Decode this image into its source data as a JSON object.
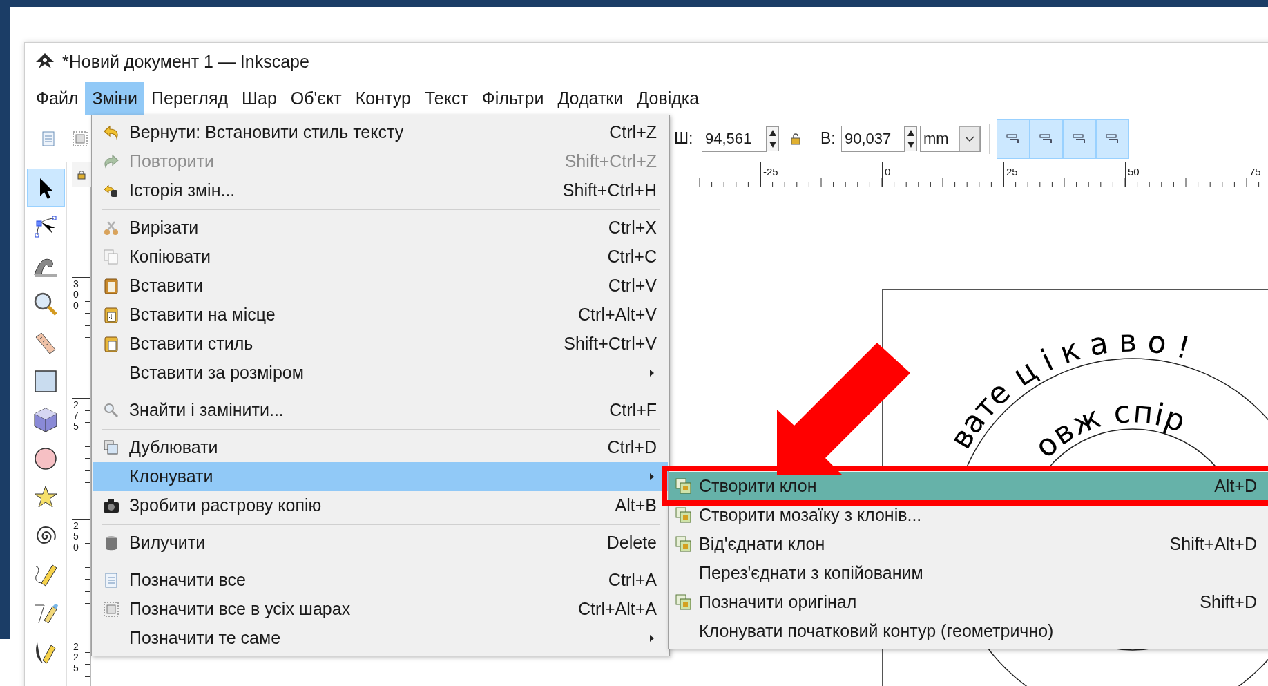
{
  "window": {
    "title": "*Новий документ 1 — Inkscape"
  },
  "menubar": [
    {
      "label": "Файл",
      "selected": false
    },
    {
      "label": "Зміни",
      "selected": true
    },
    {
      "label": "Перегляд",
      "selected": false
    },
    {
      "label": "Шар",
      "selected": false
    },
    {
      "label": "Об'єкт",
      "selected": false
    },
    {
      "label": "Контур",
      "selected": false
    },
    {
      "label": "Текст",
      "selected": false
    },
    {
      "label": "Фільтри",
      "selected": false
    },
    {
      "label": "Додатки",
      "selected": false
    },
    {
      "label": "Довідка",
      "selected": false
    }
  ],
  "toolbar": {
    "width_label": "Ш:",
    "width_value": "94,561",
    "height_label": "В:",
    "height_value": "90,037",
    "unit": "mm",
    "toggles": [
      {
        "selected": true
      },
      {
        "selected": true
      },
      {
        "selected": true
      },
      {
        "selected": true
      }
    ]
  },
  "toolbox": [
    {
      "selected": true
    },
    {
      "selected": false
    },
    {
      "selected": false
    },
    {
      "selected": false
    },
    {
      "selected": false
    },
    {
      "selected": false
    },
    {
      "selected": false
    },
    {
      "selected": false
    },
    {
      "selected": false
    },
    {
      "selected": false
    },
    {
      "selected": false
    },
    {
      "selected": false
    },
    {
      "selected": false
    }
  ],
  "rulers": {
    "horizontal": [
      "-25",
      "0",
      "25",
      "50",
      "75"
    ],
    "vertical": [
      "300",
      "275",
      "250",
      "225"
    ]
  },
  "canvas": {
    "curved_texts": [
      "вате",
      "цікаво!",
      "овж спір"
    ]
  },
  "edit_menu": {
    "items": [
      {
        "kind": "item",
        "label": "Вернути: Встановити стиль тексту",
        "shortcut": "Ctrl+Z",
        "disabled": false,
        "selected": false,
        "submenu": false
      },
      {
        "kind": "item",
        "label": "Повторити",
        "shortcut": "Shift+Ctrl+Z",
        "disabled": true,
        "selected": false,
        "submenu": false
      },
      {
        "kind": "item",
        "label": "Історія змін...",
        "shortcut": "Shift+Ctrl+H",
        "disabled": false,
        "selected": false,
        "submenu": false
      },
      {
        "kind": "separator"
      },
      {
        "kind": "item",
        "label": "Вирізати",
        "shortcut": "Ctrl+X",
        "disabled": false,
        "selected": false,
        "submenu": false
      },
      {
        "kind": "item",
        "label": "Копіювати",
        "shortcut": "Ctrl+C",
        "disabled": false,
        "selected": false,
        "submenu": false
      },
      {
        "kind": "item",
        "label": "Вставити",
        "shortcut": "Ctrl+V",
        "disabled": false,
        "selected": false,
        "submenu": false
      },
      {
        "kind": "item",
        "label": "Вставити на місце",
        "shortcut": "Ctrl+Alt+V",
        "disabled": false,
        "selected": false,
        "submenu": false
      },
      {
        "kind": "item",
        "label": "Вставити стиль",
        "shortcut": "Shift+Ctrl+V",
        "disabled": false,
        "selected": false,
        "submenu": false
      },
      {
        "kind": "item",
        "label": "Вставити за розміром",
        "disabled": false,
        "selected": false,
        "submenu": true
      },
      {
        "kind": "separator"
      },
      {
        "kind": "item",
        "label": "Знайти і замінити...",
        "shortcut": "Ctrl+F",
        "disabled": false,
        "selected": false,
        "submenu": false
      },
      {
        "kind": "separator"
      },
      {
        "kind": "item",
        "label": "Дублювати",
        "shortcut": "Ctrl+D",
        "disabled": false,
        "selected": false,
        "submenu": false
      },
      {
        "kind": "item",
        "label": "Клонувати",
        "disabled": false,
        "selected": true,
        "submenu": true
      },
      {
        "kind": "item",
        "label": "Зробити растрову копію",
        "shortcut": "Alt+B",
        "disabled": false,
        "selected": false,
        "submenu": false
      },
      {
        "kind": "separator"
      },
      {
        "kind": "item",
        "label": "Вилучити",
        "shortcut": "Delete",
        "disabled": false,
        "selected": false,
        "submenu": false
      },
      {
        "kind": "separator"
      },
      {
        "kind": "item",
        "label": "Позначити все",
        "shortcut": "Ctrl+A",
        "disabled": false,
        "selected": false,
        "submenu": false
      },
      {
        "kind": "item",
        "label": "Позначити все в усіх шарах",
        "shortcut": "Ctrl+Alt+A",
        "disabled": false,
        "selected": false,
        "submenu": false
      },
      {
        "kind": "item",
        "label": "Позначити те саме",
        "disabled": false,
        "selected": false,
        "submenu": true
      }
    ]
  },
  "clone_submenu": {
    "items": [
      {
        "label": "Створити клон",
        "shortcut": "Alt+D",
        "selected": true
      },
      {
        "label": "Створити мозаїку з клонів...",
        "selected": false
      },
      {
        "label": "Від'єднати клон",
        "shortcut": "Shift+Alt+D",
        "selected": false
      },
      {
        "label": "Перез'єднати з копійованим",
        "selected": false
      },
      {
        "label": "Позначити оригінал",
        "shortcut": "Shift+D",
        "selected": false
      },
      {
        "label": "Клонувати початковий контур (геометрично)",
        "selected": false
      }
    ]
  }
}
